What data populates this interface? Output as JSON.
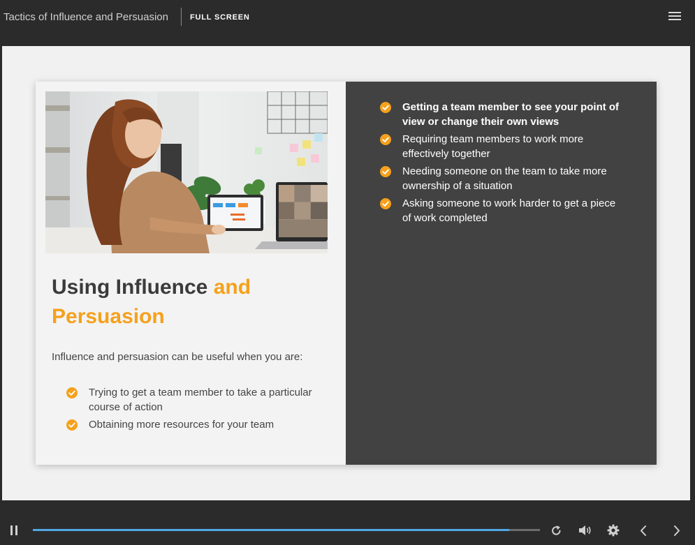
{
  "header": {
    "course_title": "Tactics of Influence and Persuasion",
    "fullscreen_label": "FULL SCREEN",
    "menu_icon": "hamburger-menu-icon"
  },
  "slide": {
    "photo_description": "woman-on-video-call-photo",
    "heading_part1": "Using Influence ",
    "heading_part2": "and Persuasion",
    "intro": "Influence and persuasion can be useful when you are:",
    "left_items": [
      "Trying to get a team member to take a particular course of action",
      "Obtaining more resources for your team"
    ],
    "right_items": [
      "Getting a team member to see your point of view or change their own views",
      "Requiring team members to work more effectively together",
      "Needing someone on the team to take more ownership of a situation",
      "Asking someone to work harder to get a piece of work completed"
    ],
    "accent_color": "#f5a11c",
    "dark_panel_color": "#424242"
  },
  "player": {
    "progress": 0.94,
    "progress_color": "#4fa8e6",
    "icons": [
      "pause-icon",
      "replay-icon",
      "volume-icon",
      "settings-icon",
      "previous-icon",
      "next-icon"
    ]
  }
}
